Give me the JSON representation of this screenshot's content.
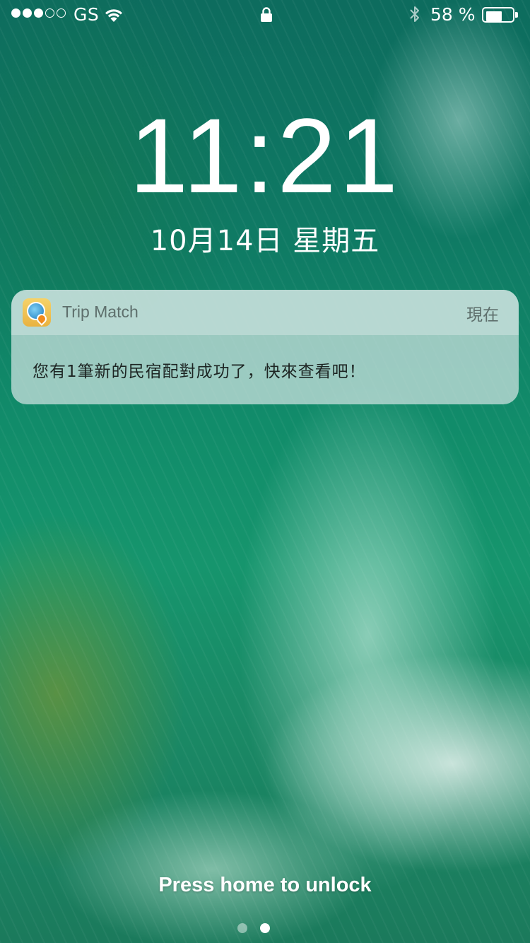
{
  "status_bar": {
    "carrier": "GS",
    "signal_bars_filled": 3,
    "signal_bars_total": 5,
    "battery_percent": "58 %",
    "battery_level": 0.58,
    "icons": [
      "signal-dots",
      "wifi-icon",
      "lock-icon",
      "bluetooth-icon",
      "battery-icon"
    ]
  },
  "lock_screen": {
    "time": "11:21",
    "date": "10月14日 星期五",
    "unlock_hint": "Press home to unlock"
  },
  "notification": {
    "app_name": "Trip Match",
    "time": "現在",
    "message": "您有1筆新的民宿配對成功了，快來查看吧！",
    "app_icon": "trip-match-app-icon"
  },
  "page_indicator": {
    "count": 2,
    "active_index": 1
  },
  "colors": {
    "text": "#ffffff",
    "notification_bg": "#c3deda",
    "notification_text": "#1d2523",
    "notification_meta": "#5e6f6c"
  }
}
